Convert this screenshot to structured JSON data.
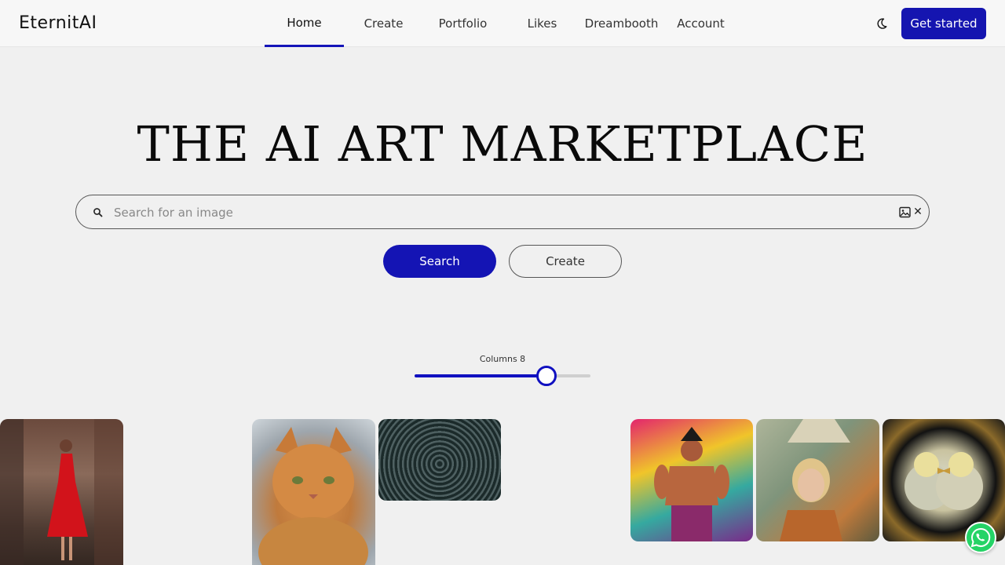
{
  "brand": {
    "logo_text": "EternitAI"
  },
  "nav": {
    "items": [
      {
        "label": "Home",
        "active": true
      },
      {
        "label": "Create",
        "active": false
      },
      {
        "label": "Portfolio",
        "active": false
      },
      {
        "label": "Likes",
        "active": false
      },
      {
        "label": "Dreambooth",
        "active": false
      },
      {
        "label": "Account",
        "active": false
      }
    ]
  },
  "header": {
    "theme_icon": "moon-icon",
    "get_started_label": "Get started"
  },
  "hero": {
    "title": "THE AI ART MARKETPLACE"
  },
  "search": {
    "placeholder": "Search for an image",
    "value": "",
    "search_icon": "search-icon",
    "image_icon": "image-icon",
    "clear_icon": "close-icon"
  },
  "actions": {
    "search_label": "Search",
    "create_label": "Create"
  },
  "columns_slider": {
    "label": "Columns 8",
    "value": 8,
    "fill_fraction": 0.75
  },
  "gallery": {
    "images": [
      {
        "name": "woman-red-dress-image"
      },
      {
        "name": "orange-cat-image"
      },
      {
        "name": "water-ripple-image"
      },
      {
        "name": "warrior-illustration-image"
      },
      {
        "name": "blonde-woman-image"
      },
      {
        "name": "chicks-nest-image"
      }
    ]
  },
  "colors": {
    "accent": "#1414b4",
    "background": "#f0f0f0",
    "whatsapp": "#25d366"
  },
  "floating": {
    "whatsapp_icon": "whatsapp-icon"
  }
}
